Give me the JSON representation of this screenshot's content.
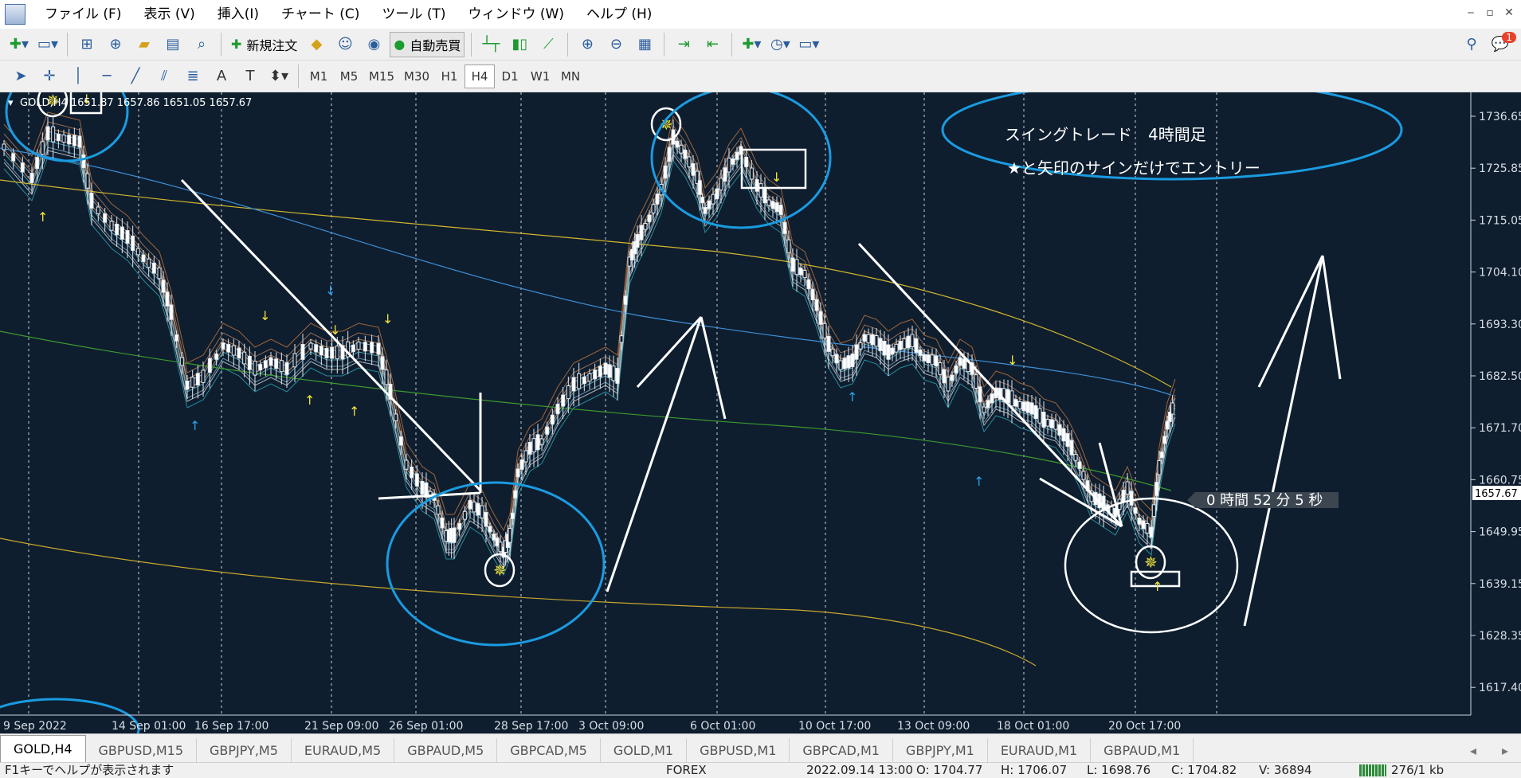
{
  "menu": [
    "ファイル (F)",
    "表示 (V)",
    "挿入(I)",
    "チャート (C)",
    "ツール (T)",
    "ウィンドウ (W)",
    "ヘルプ (H)"
  ],
  "toolbar": {
    "new_order_label": "新規注文",
    "auto_trade_label": "自動売買",
    "notification_count": "1"
  },
  "timeframes": [
    "M1",
    "M5",
    "M15",
    "M30",
    "H1",
    "H4",
    "D1",
    "W1",
    "MN"
  ],
  "active_timeframe": "H4",
  "chart": {
    "header": "GOLD,H4  1651.87 1657.86 1651.05 1657.67",
    "price_labels": [
      "1736.65",
      "1725.85",
      "1715.05",
      "1704.10",
      "1693.30",
      "1682.50",
      "1671.70",
      "1660.75",
      "1649.95",
      "1639.15",
      "1628.35",
      "1617.40"
    ],
    "current_price": "1657.67",
    "time_labels": [
      "9 Sep 2022",
      "14 Sep 01:00",
      "16 Sep 17:00",
      "21 Sep 09:00",
      "26 Sep 01:00",
      "28 Sep 17:00",
      "3 Oct 09:00",
      "6 Oct 01:00",
      "10 Oct 17:00",
      "13 Oct 09:00",
      "18 Oct 01:00",
      "20 Oct 17:00"
    ],
    "countdown": "0 時間 52 分 5 秒",
    "annotation_line1": "スイングトレード　4時間足",
    "annotation_line2": "★と矢印のサインだけでエントリー",
    "colors": {
      "background": "#0e1e2f",
      "circle": "#1a9be0",
      "annotation": "#ffffff"
    }
  },
  "tabs": [
    "GOLD,H4",
    "GBPUSD,M15",
    "GBPJPY,M5",
    "EURAUD,M5",
    "GBPAUD,M5",
    "GBPCAD,M5",
    "GOLD,M1",
    "GBPUSD,M1",
    "GBPCAD,M1",
    "GBPJPY,M1",
    "EURAUD,M1",
    "GBPAUD,M1"
  ],
  "active_tab": "GOLD,H4",
  "status": {
    "help": "F1キーでヘルプが表示されます",
    "profile": "FOREX",
    "datetime": "2022.09.14 13:00",
    "open": "O: 1704.77",
    "high": "H: 1706.07",
    "low": "L: 1698.76",
    "close": "C: 1704.82",
    "volume": "V: 36894",
    "traffic": "276/1 kb"
  }
}
